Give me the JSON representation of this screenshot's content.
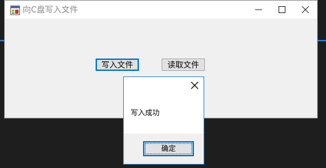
{
  "window": {
    "title": "向C盘写入文件",
    "icon": "app-form-icon",
    "controls": [
      "minimize-icon",
      "maximize-icon",
      "close-icon"
    ]
  },
  "main": {
    "write_button_label": "写入文件",
    "read_button_label": "读取文件"
  },
  "message_box": {
    "message": "写入成功",
    "ok_label": "确定",
    "close_icon": "close-icon"
  },
  "colors": {
    "accent": "#0078d7",
    "window_bg": "#f0f0f0",
    "desktop_bg": "#1e1e1e"
  }
}
